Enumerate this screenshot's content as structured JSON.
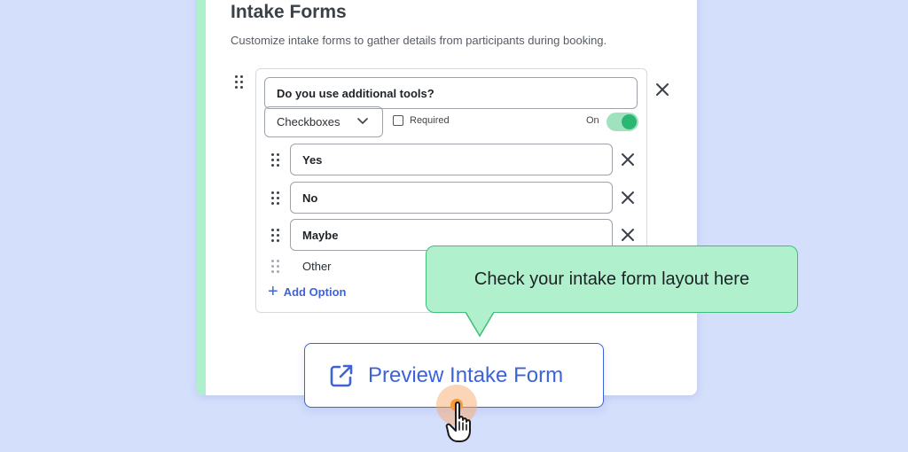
{
  "card": {
    "title": "Intake Forms",
    "subtitle": "Customize intake forms to gather details from participants during booking."
  },
  "question": {
    "text": "Do you use additional tools?",
    "type_value": "Checkboxes",
    "required_label": "Required",
    "required_checked": false,
    "toggle_label": "On",
    "toggle_on": true
  },
  "options": [
    {
      "label": "Yes"
    },
    {
      "label": "No"
    },
    {
      "label": "Maybe"
    }
  ],
  "other_label": "Other",
  "add_option_label": "Add Option",
  "tooltip_text": "Check your intake form layout here",
  "preview_button_label": "Preview Intake Form",
  "icons": {
    "drag": "drag-handle-icon",
    "remove": "close-icon",
    "dropdown": "chevron-down-icon",
    "add": "plus-icon",
    "external": "external-link-icon",
    "cursor": "hand-pointer-icon"
  },
  "colors": {
    "background": "#d4dffc",
    "accent_green": "#adf0cc",
    "toggle_green": "#2bb673",
    "primary_blue": "#3d63d6",
    "tooltip_bg": "#b1f0cc"
  }
}
